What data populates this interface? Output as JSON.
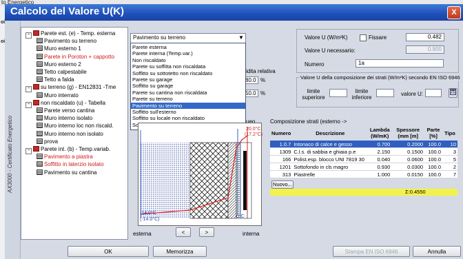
{
  "background_app": {
    "title": "to Energetico",
    "left_panel_texts": [
      "oic",
      "oic"
    ]
  },
  "window": {
    "title": "Calcolo del Valore U(K)",
    "close_label": "X",
    "sidebar_text": "AX3000 - Certificato Energetico"
  },
  "tree": [
    {
      "label": "Parete est. (e) - Temp. esterna",
      "indent": 0,
      "kind": "root",
      "color": "black"
    },
    {
      "label": "Pavimento su terreno",
      "indent": 1,
      "kind": "leaf",
      "color": "black"
    },
    {
      "label": "Muro esterno 1",
      "indent": 1,
      "kind": "leaf",
      "color": "black"
    },
    {
      "label": "Parete in Poroton + cappotto",
      "indent": 1,
      "kind": "leaf",
      "color": "red"
    },
    {
      "label": "Muro esterno 2",
      "indent": 1,
      "kind": "leaf",
      "color": "black"
    },
    {
      "label": "Tetto calpestabile",
      "indent": 1,
      "kind": "leaf",
      "color": "black"
    },
    {
      "label": "Tetto a falda",
      "indent": 1,
      "kind": "leaf",
      "color": "black"
    },
    {
      "label": "su terreno (g) - EN12831 -Tme",
      "indent": 0,
      "kind": "root",
      "color": "black"
    },
    {
      "label": "Muro interrato",
      "indent": 1,
      "kind": "leaf",
      "color": "black"
    },
    {
      "label": "non riscaldato (u) - Tabella",
      "indent": 0,
      "kind": "root",
      "color": "black"
    },
    {
      "label": "Parete verso cantina",
      "indent": 1,
      "kind": "leaf",
      "color": "black"
    },
    {
      "label": "Muro interno isolato",
      "indent": 1,
      "kind": "leaf",
      "color": "black"
    },
    {
      "label": "Muro interno loc non riscald.",
      "indent": 1,
      "kind": "leaf",
      "color": "black"
    },
    {
      "label": "Muro interno non isolato",
      "indent": 1,
      "kind": "leaf",
      "color": "black"
    },
    {
      "label": "prova",
      "indent": 1,
      "kind": "leaf",
      "color": "black"
    },
    {
      "label": "Parete int. (b) - Temp.variab.",
      "indent": 0,
      "kind": "root",
      "color": "black"
    },
    {
      "label": "Pavimento a piastra",
      "indent": 1,
      "kind": "leaf",
      "color": "red"
    },
    {
      "label": "Soffitto in laterzio isolato",
      "indent": 1,
      "kind": "leaf",
      "color": "red"
    },
    {
      "label": "Pavimento su cantina",
      "indent": 1,
      "kind": "leaf",
      "color": "black"
    }
  ],
  "type_select": {
    "value": "Pavimento su terreno",
    "options": [
      "Parete esterna",
      "Parete interna (Temp.var.)",
      "Non riscaldato",
      "Parete su soffitta non riscaldata",
      "Soffitto su sottotetto non riscaldato",
      "Parete su garage",
      "Soffitto su garage",
      "Parete su cantina non riscaldata",
      "Parete su terreno",
      "Pavimento su terreno",
      "Soffitto sull'esterno",
      "Soffitto su locale non riscaldato",
      "Soffitto su altri appartamenti"
    ],
    "selected_index": 9
  },
  "behind_list": {
    "humidity_label": "idita relativa",
    "val1": "80.0",
    "unit1": "%",
    "val2": "50.0",
    "unit2": "%",
    "partial": "ueo"
  },
  "u_values": {
    "valore_u_label": "Valore U  (W/m²K)",
    "fissare_label": "Fissare",
    "valore_u": "0.482",
    "necessario_label": "Valore U necessario:",
    "necessario": "0.800",
    "numero_label": "Numero",
    "numero": "1a"
  },
  "iso_group": {
    "title": "Valore U della composizione dei strati (W/m²K) secondo EN ISO 6946",
    "limite_sup": "limite superiore",
    "limite_inf": "limite inferiore",
    "valore_u": "valore U:"
  },
  "diagram": {
    "top_temp": "20.0°C",
    "top_temp2": "(17.2°C)",
    "bottom_left": "-14.0°C",
    "bottom_left2": "(-14.0°C)",
    "zero": "0°C",
    "esterna_label": "esterna",
    "interna_label": "interna",
    "prev_label": "<",
    "next_label": ">"
  },
  "strata": {
    "title": "Composizione strati (esterno ->",
    "columns": [
      "Numero",
      "Descrizione",
      "Lambda (W/mK)",
      "Spessore (mm [m]",
      "Parte [%]",
      "Tipo"
    ],
    "rows": [
      {
        "numero": "1.0.7",
        "descrizione": "Intonaco di calce e gesso",
        "lambda": "0.700",
        "spessore": "0.2000",
        "parte": "100.0",
        "tipo": "10",
        "selected": true
      },
      {
        "numero": "1309",
        "descrizione": "C.l.s. di sabbia e ghiaia p.e",
        "lambda": "2.150",
        "spessore": "0.1500",
        "parte": "100.0",
        "tipo": "3",
        "selected": false
      },
      {
        "numero": "166",
        "descrizione": "Polist.esp. blocco UNI 7819 30",
        "lambda": "0.040",
        "spessore": "0.0600",
        "parte": "100.0",
        "tipo": "5",
        "selected": false
      },
      {
        "numero": "1201",
        "descrizione": "Sottofondo in cls magro",
        "lambda": "0.930",
        "spessore": "0.0300",
        "parte": "100.0",
        "tipo": "2",
        "selected": false
      },
      {
        "numero": "313",
        "descrizione": "Piastrelle",
        "lambda": "1.000",
        "spessore": "0.0150",
        "parte": "100.0",
        "tipo": "7",
        "selected": false
      }
    ],
    "new_label": "Nuovo...",
    "sum": "Σ:0.4550"
  },
  "buttons": {
    "ok": "OK",
    "memorizza": "Memorizza",
    "stampa": "Stampa EN ISO 6946",
    "annulla": "Annulla"
  }
}
